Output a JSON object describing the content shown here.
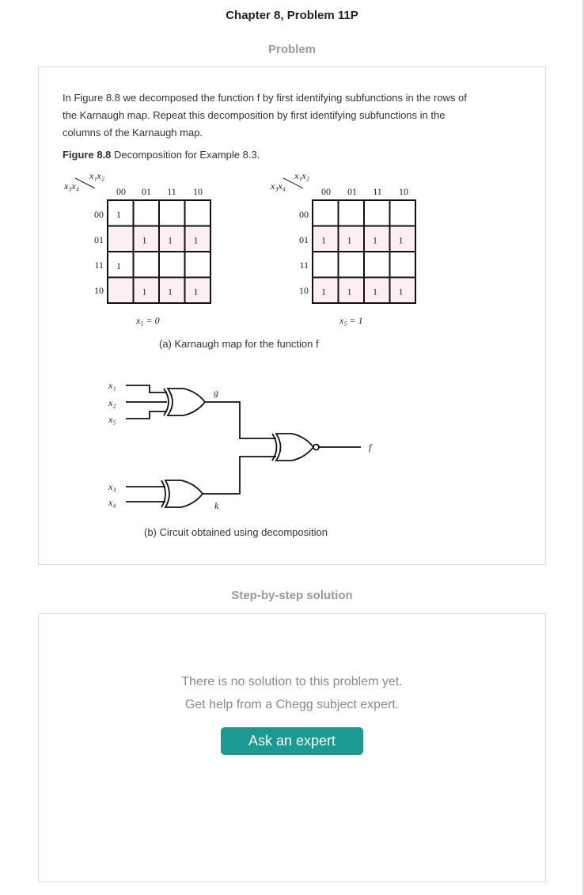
{
  "header": {
    "title": "Chapter 8, Problem 11P"
  },
  "problem_section": {
    "label": "Problem",
    "text_lines": [
      "In Figure 8.8 we decomposed the function f by first identifying subfunctions in the rows of",
      "the Karnaugh map. Repeat this decomposition by first identifying subfunctions in the",
      "columns of the Karnaugh map."
    ],
    "figure": {
      "caption_label": "Figure 8.8",
      "caption_text": " Decomposition for Example 8.3.",
      "kmap_col_var": "x₁x₂",
      "kmap_row_var": "x₃x₄",
      "col_labels": [
        "00",
        "01",
        "11",
        "10"
      ],
      "row_labels": [
        "00",
        "01",
        "11",
        "10"
      ],
      "kmap_left": {
        "cells": [
          [
            "1",
            "",
            "",
            ""
          ],
          [
            "",
            "1",
            "1",
            "1"
          ],
          [
            "1",
            "",
            "",
            ""
          ],
          [
            "",
            "1",
            "1",
            "1"
          ]
        ],
        "shaded_rows": [
          1,
          3
        ],
        "label": "x₅ = 0"
      },
      "kmap_right": {
        "cells": [
          [
            "",
            "",
            "",
            ""
          ],
          [
            "1",
            "1",
            "1",
            "1"
          ],
          [
            "",
            "",
            "",
            ""
          ],
          [
            "1",
            "1",
            "1",
            "1"
          ]
        ],
        "shaded_rows": [
          1,
          3
        ],
        "label": "x₅ = 1"
      },
      "subcaption_a": "(a) Karnaugh map for the function f",
      "circuit": {
        "inputs_top": [
          "x₁",
          "x₂",
          "x₅"
        ],
        "inputs_bottom": [
          "x₃",
          "x₄"
        ],
        "signal_g": "g",
        "signal_k": "k",
        "output": "f"
      },
      "subcaption_b": "(b) Circuit obtained using decomposition"
    }
  },
  "solution_section": {
    "label": "Step-by-step solution",
    "empty_line1": "There is no solution to this problem yet.",
    "empty_line2": "Get help from a Chegg subject expert.",
    "button_label": "Ask an expert"
  },
  "colors": {
    "accent": "#1a9a92",
    "shaded_cell": "#fdeef5",
    "border": "#dcdcdc"
  }
}
